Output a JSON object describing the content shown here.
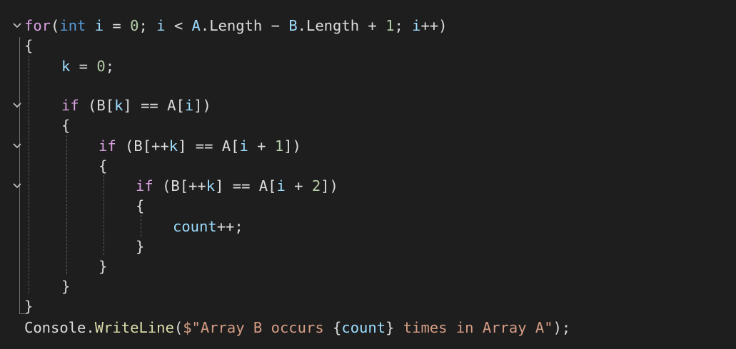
{
  "code": {
    "line1": {
      "for": "for",
      "open": "(",
      "int": "int",
      "i": "i",
      "eq": " = ",
      "zero": "0",
      "semi1": "; ",
      "i2": "i",
      "lt": " < ",
      "A": "A",
      "dot1": ".",
      "length1": "Length",
      "minus": " − ",
      "B": "B",
      "dot2": ".",
      "length2": "Length",
      "plus": " + ",
      "one": "1",
      "semi2": "; ",
      "i3": "i",
      "inc": "++)"
    },
    "line2": "{",
    "line3": {
      "k": "k",
      "eq": " = ",
      "zero": "0",
      "semi": ";"
    },
    "line5": {
      "if": "if",
      "p1": " (B[",
      "k": "k",
      "p2": "] == A[",
      "i": "i",
      "p3": "])"
    },
    "line6": "{",
    "line7": {
      "if": "if",
      "p1": " (B[++",
      "k": "k",
      "p2": "] == A[",
      "i": "i",
      "p3": " + ",
      "one": "1",
      "p4": "])"
    },
    "line8": "{",
    "line9": {
      "if": "if",
      "p1": " (B[++",
      "k": "k",
      "p2": "] == A[",
      "i": "i",
      "p3": " + ",
      "two": "2",
      "p4": "])"
    },
    "line10": "{",
    "line11": {
      "count": "count",
      "rest": "++;"
    },
    "line12": "}",
    "line13": "}",
    "line14": "}",
    "line15": "}",
    "line16": {
      "console": "Console",
      "dot": ".",
      "writeline": "WriteLine",
      "open": "(",
      "str1": "$\"Array B occurs ",
      "brace_open": "{",
      "count": "count",
      "brace_close": "}",
      "str2": " times in Array A\"",
      "close": ");"
    }
  },
  "colors": {
    "background": "#1e1e1e",
    "keyword": "#569cd6",
    "control": "#d8a0df",
    "variable": "#9cdcfe",
    "number": "#b5cea8",
    "string": "#d69d85",
    "method": "#dcdcaa",
    "plain": "#dcdcdc"
  },
  "icons": [
    "fold-chevron-icon"
  ]
}
